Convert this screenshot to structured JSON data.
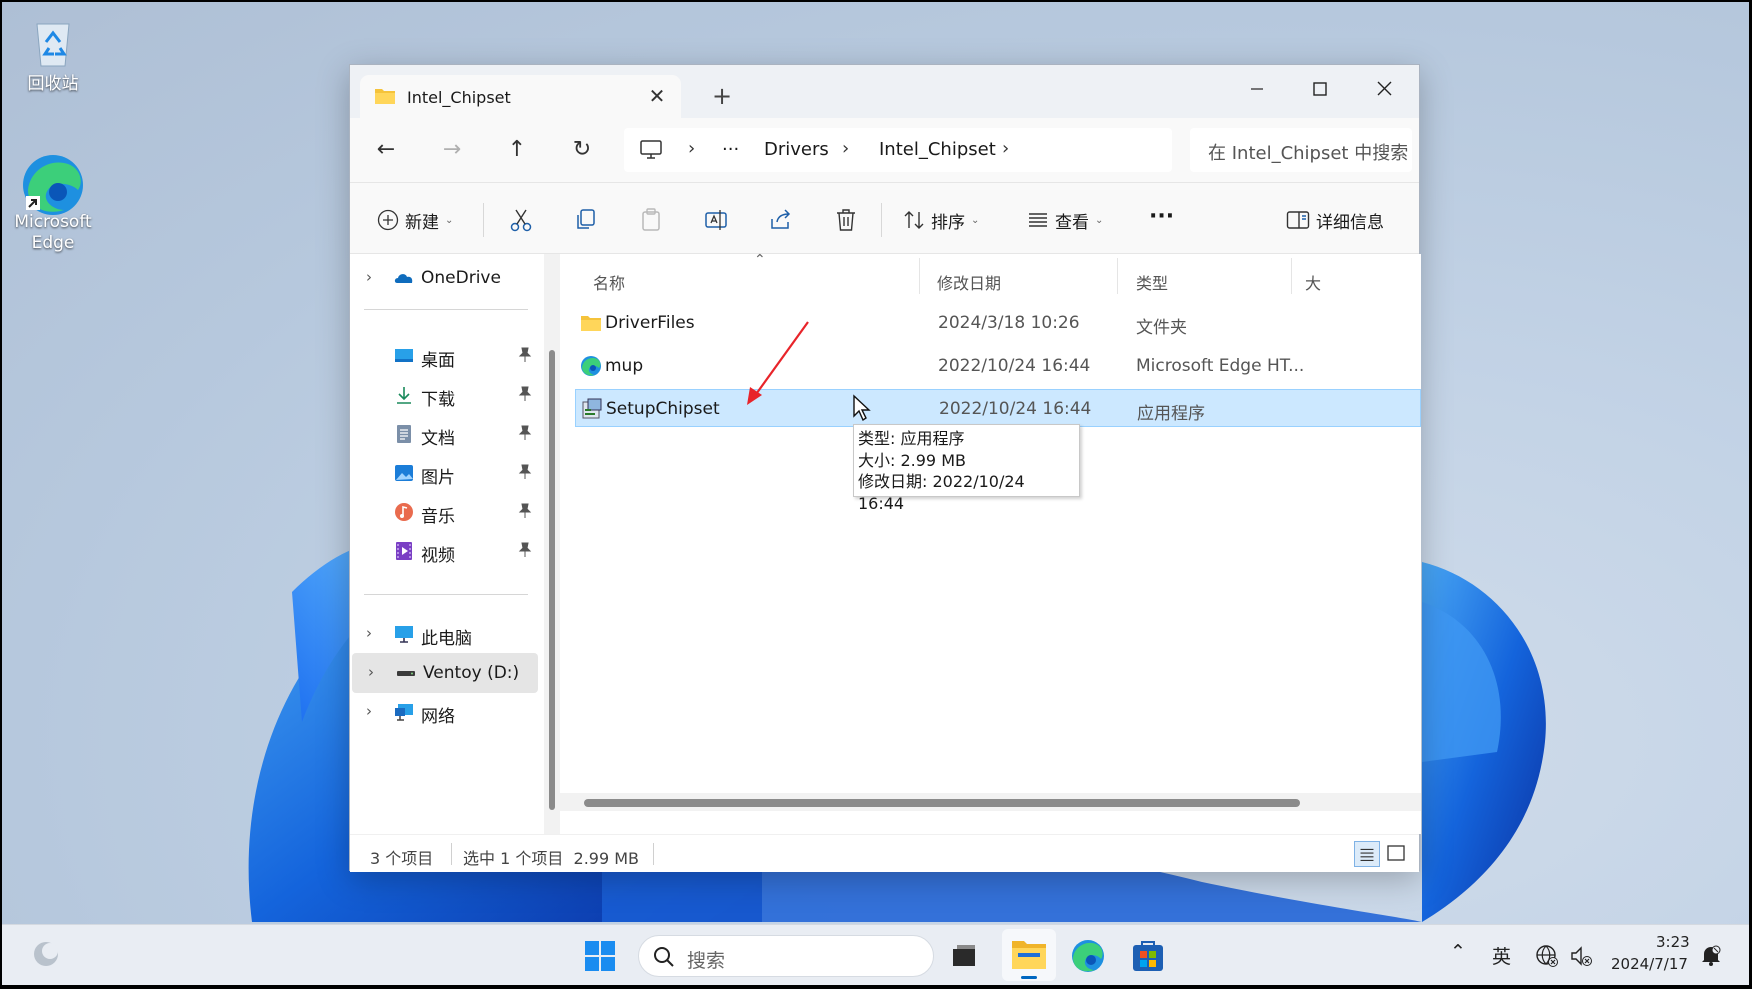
{
  "desktop": {
    "icons": [
      {
        "name": "recycle-bin",
        "label": "回收站"
      },
      {
        "name": "microsoft-edge",
        "label": "Microsoft\nEdge"
      }
    ]
  },
  "window": {
    "tab_title": "Intel_Chipset",
    "new_tab": "+",
    "controls": {
      "minimize": "—",
      "maximize": "▢",
      "close": "✕"
    }
  },
  "address": {
    "breadcrumbs": [
      "Drivers",
      "Intel_Chipset"
    ],
    "overflow": "···",
    "search_placeholder": "在 Intel_Chipset 中搜索"
  },
  "toolbar": {
    "new_label": "新建",
    "sort_label": "排序",
    "view_label": "查看",
    "more_label": "···",
    "details_label": "详细信息"
  },
  "sidebar": {
    "onedrive": "OneDrive",
    "quick": [
      {
        "label": "桌面",
        "icon": "desktop-icon"
      },
      {
        "label": "下载",
        "icon": "download-icon"
      },
      {
        "label": "文档",
        "icon": "documents-icon"
      },
      {
        "label": "图片",
        "icon": "pictures-icon"
      },
      {
        "label": "音乐",
        "icon": "music-icon"
      },
      {
        "label": "视频",
        "icon": "videos-icon"
      }
    ],
    "this_pc": "此电脑",
    "ventoy": "Ventoy (D:)",
    "network": "网络"
  },
  "columns": {
    "name": "名称",
    "date": "修改日期",
    "type": "类型",
    "size": "大小"
  },
  "files": [
    {
      "name": "DriverFiles",
      "date": "2024/3/18 10:26",
      "type": "文件夹",
      "icon": "folder-icon"
    },
    {
      "name": "mup",
      "date": "2022/10/24 16:44",
      "type": "Microsoft Edge HT...",
      "icon": "edge-html-icon"
    },
    {
      "name": "SetupChipset",
      "date": "2022/10/24 16:44",
      "type": "应用程序",
      "icon": "setup-exe-icon",
      "selected": true
    }
  ],
  "tooltip": {
    "type": "类型: 应用程序",
    "size": "大小: 2.99 MB",
    "date": "修改日期: 2022/10/24 16:44"
  },
  "status": {
    "count": "3 个项目",
    "selected": "选中 1 个项目  2.99 MB"
  },
  "taskbar": {
    "search_placeholder": "搜索",
    "ime": "英",
    "time": "3:23",
    "date": "2024/7/17"
  },
  "colors": {
    "selection": "#cce8ff",
    "accent": "#0067c0",
    "annotation_arrow": "#e8242a"
  }
}
